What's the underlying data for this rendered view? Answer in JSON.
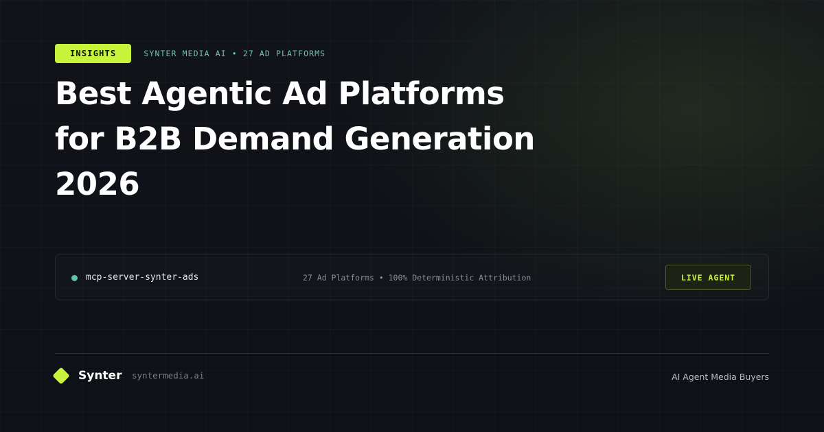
{
  "header": {
    "badge_label": "INSIGHTS",
    "meta_text": "SYNTER MEDIA AI • 27 AD PLATFORMS"
  },
  "title": {
    "lines": [
      "Best Agentic Ad Platforms",
      "for B2B Demand Generation",
      "2026"
    ]
  },
  "panel": {
    "status_icon": "status-dot-icon",
    "server_name": "mcp-server-synter-ads",
    "stats_text": "27 Ad Platforms • 100% Deterministic Attribution",
    "button_label": "LIVE AGENT"
  },
  "footer": {
    "logo_icon": "diamond-logo-icon",
    "brand_name": "Synter",
    "domain": "syntermedia.ai",
    "tagline": "AI Agent Media Buyers"
  },
  "colors": {
    "accent": "#c8f53c",
    "teal": "#5fc5b0",
    "background": "#0f1217"
  }
}
